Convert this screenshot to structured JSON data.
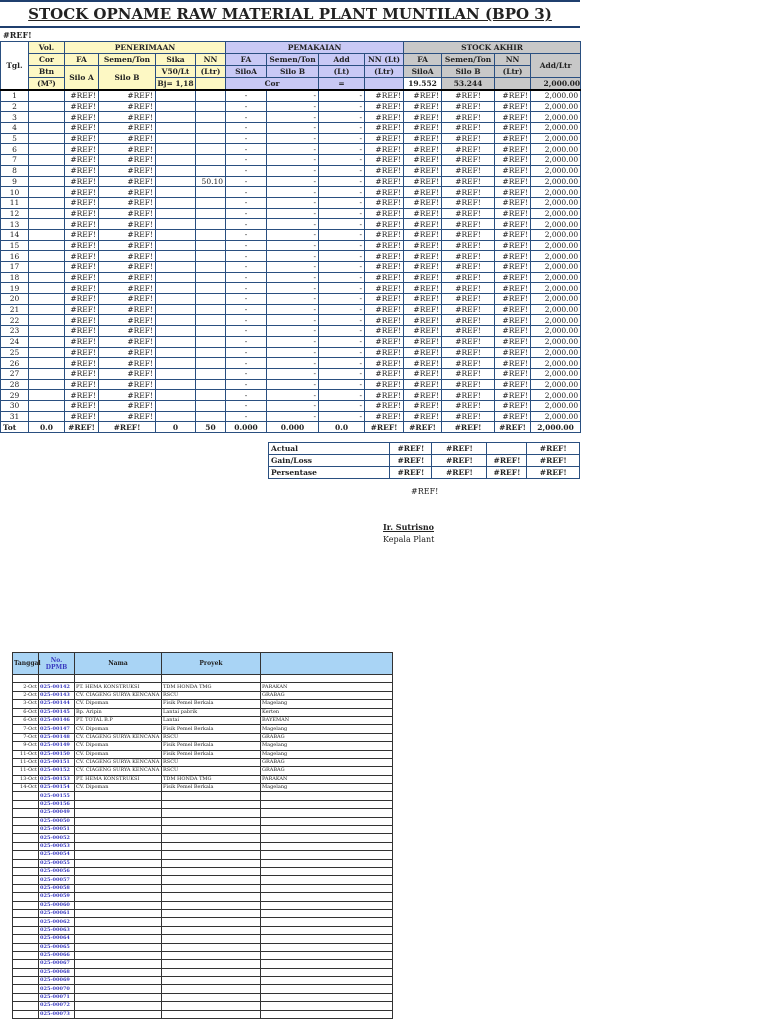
{
  "title": "STOCK OPNAME RAW MATERIAL PLANT MUNTILAN (BPO 3)",
  "ref_label": "#REF!",
  "headers": {
    "tgl": "Tgl.",
    "vol": "Vol.",
    "cor": "Cor",
    "btn": "Btn",
    "m3": "(M³)",
    "penerimaan": "PENERIMAAN",
    "pemakaian": "PEMAKAIAN",
    "stock_akhir": "STOCK AKHIR",
    "fa": "FA",
    "semen_ton": "Semen/Ton",
    "sika": "Sika",
    "v50": "V50/Lt",
    "nn": "NN",
    "ltr": "(Ltr)",
    "silo_a": "Silo A",
    "silo_b": "Silo B",
    "bj": "Bj= 1,18",
    "siloa": "SiloA",
    "add": "Add",
    "lt": "(Lt)",
    "nn_lt": "NN  (Lt)",
    "cor2": "Cor",
    "eq": "=",
    "add_ltr": "Add/Ltr",
    "stock_fa": "19.552",
    "stock_semen": "53.244",
    "stock_add": "2,000.00"
  },
  "rows": [
    [
      "1",
      "",
      "#REF!",
      "#REF!",
      "",
      "",
      "-",
      "-",
      "-",
      "#REF!",
      "#REF!",
      "#REF!",
      "#REF!",
      "2,000.00"
    ],
    [
      "2",
      "",
      "#REF!",
      "#REF!",
      "",
      "",
      "-",
      "-",
      "-",
      "#REF!",
      "#REF!",
      "#REF!",
      "#REF!",
      "2,000.00"
    ],
    [
      "3",
      "",
      "#REF!",
      "#REF!",
      "",
      "",
      "-",
      "-",
      "-",
      "#REF!",
      "#REF!",
      "#REF!",
      "#REF!",
      "2,000.00"
    ],
    [
      "4",
      "",
      "#REF!",
      "#REF!",
      "",
      "",
      "-",
      "-",
      "-",
      "#REF!",
      "#REF!",
      "#REF!",
      "#REF!",
      "2,000.00"
    ],
    [
      "5",
      "",
      "#REF!",
      "#REF!",
      "",
      "",
      "-",
      "-",
      "-",
      "#REF!",
      "#REF!",
      "#REF!",
      "#REF!",
      "2,000.00"
    ],
    [
      "6",
      "",
      "#REF!",
      "#REF!",
      "",
      "",
      "-",
      "-",
      "-",
      "#REF!",
      "#REF!",
      "#REF!",
      "#REF!",
      "2,000.00"
    ],
    [
      "7",
      "",
      "#REF!",
      "#REF!",
      "",
      "",
      "-",
      "-",
      "-",
      "#REF!",
      "#REF!",
      "#REF!",
      "#REF!",
      "2,000.00"
    ],
    [
      "8",
      "",
      "#REF!",
      "#REF!",
      "",
      "",
      "-",
      "-",
      "-",
      "#REF!",
      "#REF!",
      "#REF!",
      "#REF!",
      "2,000.00"
    ],
    [
      "9",
      "",
      "#REF!",
      "#REF!",
      "",
      "50.10",
      "-",
      "-",
      "-",
      "#REF!",
      "#REF!",
      "#REF!",
      "#REF!",
      "2,000.00"
    ],
    [
      "10",
      "",
      "#REF!",
      "#REF!",
      "",
      "",
      "-",
      "-",
      "-",
      "#REF!",
      "#REF!",
      "#REF!",
      "#REF!",
      "2,000.00"
    ],
    [
      "11",
      "",
      "#REF!",
      "#REF!",
      "",
      "",
      "-",
      "-",
      "-",
      "#REF!",
      "#REF!",
      "#REF!",
      "#REF!",
      "2,000.00"
    ],
    [
      "12",
      "",
      "#REF!",
      "#REF!",
      "",
      "",
      "-",
      "-",
      "-",
      "#REF!",
      "#REF!",
      "#REF!",
      "#REF!",
      "2,000.00"
    ],
    [
      "13",
      "",
      "#REF!",
      "#REF!",
      "",
      "",
      "-",
      "-",
      "-",
      "#REF!",
      "#REF!",
      "#REF!",
      "#REF!",
      "2,000.00"
    ],
    [
      "14",
      "",
      "#REF!",
      "#REF!",
      "",
      "",
      "-",
      "-",
      "-",
      "#REF!",
      "#REF!",
      "#REF!",
      "#REF!",
      "2,000.00"
    ],
    [
      "15",
      "",
      "#REF!",
      "#REF!",
      "",
      "",
      "-",
      "-",
      "-",
      "#REF!",
      "#REF!",
      "#REF!",
      "#REF!",
      "2,000.00"
    ],
    [
      "16",
      "",
      "#REF!",
      "#REF!",
      "",
      "",
      "-",
      "-",
      "-",
      "#REF!",
      "#REF!",
      "#REF!",
      "#REF!",
      "2,000.00"
    ],
    [
      "17",
      "",
      "#REF!",
      "#REF!",
      "",
      "",
      "-",
      "-",
      "-",
      "#REF!",
      "#REF!",
      "#REF!",
      "#REF!",
      "2,000.00"
    ],
    [
      "18",
      "",
      "#REF!",
      "#REF!",
      "",
      "",
      "-",
      "-",
      "-",
      "#REF!",
      "#REF!",
      "#REF!",
      "#REF!",
      "2,000.00"
    ],
    [
      "19",
      "",
      "#REF!",
      "#REF!",
      "",
      "",
      "-",
      "-",
      "-",
      "#REF!",
      "#REF!",
      "#REF!",
      "#REF!",
      "2,000.00"
    ],
    [
      "20",
      "",
      "#REF!",
      "#REF!",
      "",
      "",
      "-",
      "-",
      "-",
      "#REF!",
      "#REF!",
      "#REF!",
      "#REF!",
      "2,000.00"
    ],
    [
      "21",
      "",
      "#REF!",
      "#REF!",
      "",
      "",
      "-",
      "-",
      "-",
      "#REF!",
      "#REF!",
      "#REF!",
      "#REF!",
      "2,000.00"
    ],
    [
      "22",
      "",
      "#REF!",
      "#REF!",
      "",
      "",
      "-",
      "-",
      "-",
      "#REF!",
      "#REF!",
      "#REF!",
      "#REF!",
      "2,000.00"
    ],
    [
      "23",
      "",
      "#REF!",
      "#REF!",
      "",
      "",
      "-",
      "-",
      "-",
      "#REF!",
      "#REF!",
      "#REF!",
      "#REF!",
      "2,000.00"
    ],
    [
      "24",
      "",
      "#REF!",
      "#REF!",
      "",
      "",
      "-",
      "-",
      "-",
      "#REF!",
      "#REF!",
      "#REF!",
      "#REF!",
      "2,000.00"
    ],
    [
      "25",
      "",
      "#REF!",
      "#REF!",
      "",
      "",
      "-",
      "-",
      "-",
      "#REF!",
      "#REF!",
      "#REF!",
      "#REF!",
      "2,000.00"
    ],
    [
      "26",
      "",
      "#REF!",
      "#REF!",
      "",
      "",
      "-",
      "-",
      "-",
      "#REF!",
      "#REF!",
      "#REF!",
      "#REF!",
      "2,000.00"
    ],
    [
      "27",
      "",
      "#REF!",
      "#REF!",
      "",
      "",
      "-",
      "-",
      "-",
      "#REF!",
      "#REF!",
      "#REF!",
      "#REF!",
      "2,000.00"
    ],
    [
      "28",
      "",
      "#REF!",
      "#REF!",
      "",
      "",
      "-",
      "-",
      "-",
      "#REF!",
      "#REF!",
      "#REF!",
      "#REF!",
      "2,000.00"
    ],
    [
      "29",
      "",
      "#REF!",
      "#REF!",
      "",
      "",
      "-",
      "-",
      "-",
      "#REF!",
      "#REF!",
      "#REF!",
      "#REF!",
      "2,000.00"
    ],
    [
      "30",
      "",
      "#REF!",
      "#REF!",
      "",
      "",
      "-",
      "-",
      "-",
      "#REF!",
      "#REF!",
      "#REF!",
      "#REF!",
      "2,000.00"
    ],
    [
      "31",
      "",
      "#REF!",
      "#REF!",
      "",
      "",
      "-",
      "-",
      "-",
      "#REF!",
      "#REF!",
      "#REF!",
      "#REF!",
      "2,000.00"
    ]
  ],
  "total": [
    "Tot",
    "0.0",
    "#REF!",
    "#REF!",
    "0",
    "50",
    "0.000",
    "0.000",
    "0.0",
    "#REF!",
    "#REF!",
    "#REF!",
    "#REF!",
    "2,000.00"
  ],
  "summary": [
    {
      "label": "Actual",
      "values": [
        "#REF!",
        "#REF!",
        "",
        "#REF!"
      ]
    },
    {
      "label": "Gain/Loss",
      "values": [
        "#REF!",
        "#REF!",
        "#REF!",
        "#REF!"
      ]
    },
    {
      "label": "Persentase",
      "values": [
        "#REF!",
        "#REF!",
        "#REF!",
        "#REF!"
      ]
    }
  ],
  "footer_ref": "#REF!",
  "signer": {
    "name": "Ir. Sutrisno",
    "role": "Kepala Plant"
  },
  "dpmb": {
    "headers": [
      "Tanggal",
      "No. DPMB",
      "Nama",
      "Proyek",
      ""
    ],
    "rows": [
      [
        "2-Oct",
        "025-00142",
        "PT. HEMA KONSTRUKSI",
        "TDM HONDA TMG",
        "PARAKAN"
      ],
      [
        "2-Oct",
        "025-00143",
        "CV. CIAGENG SURYA KENCANA",
        "RSCU",
        "GRABAG"
      ],
      [
        "3-Oct",
        "025-00144",
        "CV. Dipoman",
        "Fisik Pemel Berkala",
        "Magelang"
      ],
      [
        "6-Oct",
        "025-00145",
        "Bp. Aripin",
        "Lantai pabrik",
        "Kerten"
      ],
      [
        "6-Oct",
        "025-00146",
        "PT. TOTAL B.P",
        "Lantai",
        "BAYEMAN"
      ],
      [
        "7-Oct",
        "025-00147",
        "CV. Dipoman",
        "Fisik Pemel Berkala",
        "Magelang"
      ],
      [
        "7-Oct",
        "025-00148",
        "CV. CIAGENG SURYA KENCANA",
        "RSCU",
        "GRABAG"
      ],
      [
        "9-Oct",
        "025-00149",
        "CV. Dipoman",
        "Fisik Pemel Berkala",
        "Magelang"
      ],
      [
        "11-Oct",
        "025-00150",
        "CV. Dipoman",
        "Fisik Pemel Berkala",
        "Magelang"
      ],
      [
        "11-Oct",
        "025-00151",
        "CV. CIAGENG SURYA KENCANA",
        "RSCU",
        "GRABAG"
      ],
      [
        "11-Oct",
        "025-00152",
        "CV. CIAGENG SURYA KENCANA",
        "RSCU",
        "GRABAG"
      ],
      [
        "13-Oct",
        "025-00153",
        "PT. HEMA KONSTRUKSI",
        "TDM HONDA TMG",
        "PARAKAN"
      ],
      [
        "14-Oct",
        "025-00154",
        "CV. Dipoman",
        "Fisik Pemel Berkala",
        "Magelang"
      ],
      [
        "",
        "025-00155",
        "",
        "",
        ""
      ],
      [
        "",
        "025-00156",
        "",
        "",
        ""
      ],
      [
        "",
        "025-00049",
        "",
        "",
        ""
      ],
      [
        "",
        "025-00050",
        "",
        "",
        ""
      ],
      [
        "",
        "025-00051",
        "",
        "",
        ""
      ],
      [
        "",
        "025-00052",
        "",
        "",
        ""
      ],
      [
        "",
        "025-00053",
        "",
        "",
        ""
      ],
      [
        "",
        "025-00054",
        "",
        "",
        ""
      ],
      [
        "",
        "025-00055",
        "",
        "",
        ""
      ],
      [
        "",
        "025-00056",
        "",
        "",
        ""
      ],
      [
        "",
        "025-00057",
        "",
        "",
        ""
      ],
      [
        "",
        "025-00058",
        "",
        "",
        ""
      ],
      [
        "",
        "025-00059",
        "",
        "",
        ""
      ],
      [
        "",
        "025-00060",
        "",
        "",
        ""
      ],
      [
        "",
        "025-00061",
        "",
        "",
        ""
      ],
      [
        "",
        "025-00062",
        "",
        "",
        ""
      ],
      [
        "",
        "025-00063",
        "",
        "",
        ""
      ],
      [
        "",
        "025-00064",
        "",
        "",
        ""
      ],
      [
        "",
        "025-00065",
        "",
        "",
        ""
      ],
      [
        "",
        "025-00066",
        "",
        "",
        ""
      ],
      [
        "",
        "025-00067",
        "",
        "",
        ""
      ],
      [
        "",
        "025-00068",
        "",
        "",
        ""
      ],
      [
        "",
        "025-00069",
        "",
        "",
        ""
      ],
      [
        "",
        "025-00070",
        "",
        "",
        ""
      ],
      [
        "",
        "025-00071",
        "",
        "",
        ""
      ],
      [
        "",
        "025-00072",
        "",
        "",
        ""
      ],
      [
        "",
        "025-00073",
        "",
        "",
        ""
      ]
    ]
  }
}
